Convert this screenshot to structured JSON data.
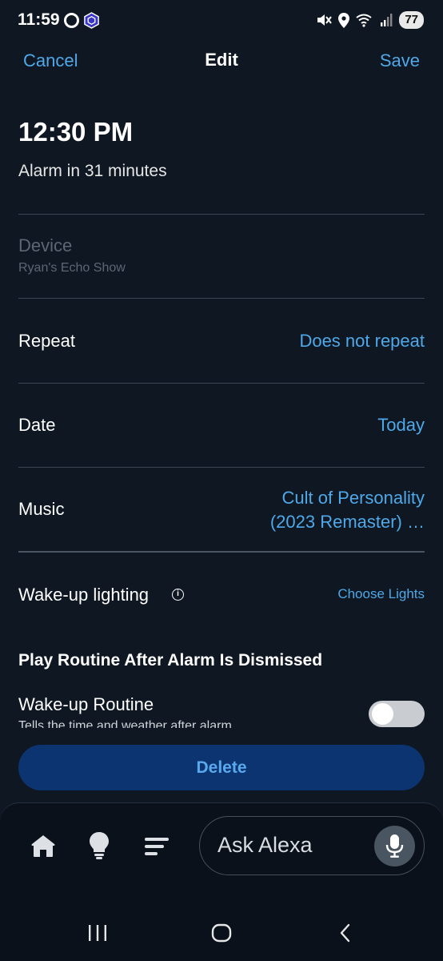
{
  "status_bar": {
    "time": "11:59",
    "battery": "77",
    "icons": [
      "circle-icon",
      "hexagon-app-icon",
      "mute-icon",
      "location-icon",
      "wifi-icon",
      "signal-icon",
      "battery-icon"
    ]
  },
  "header": {
    "cancel": "Cancel",
    "title": "Edit",
    "save": "Save"
  },
  "alarm": {
    "time": "12:30 PM",
    "subtitle": "Alarm in 31 minutes"
  },
  "device": {
    "label": "Device",
    "value": "Ryan's Echo Show"
  },
  "repeat": {
    "label": "Repeat",
    "value": "Does not repeat"
  },
  "date": {
    "label": "Date",
    "value": "Today"
  },
  "music": {
    "label": "Music",
    "value_line1": "Cult of Personality",
    "value_line2": "(2023 Remaster) …"
  },
  "wake_lighting": {
    "label": "Wake-up lighting",
    "info": "i",
    "action": "Choose Lights"
  },
  "routine": {
    "heading": "Play Routine After Alarm Is Dismissed",
    "label": "Wake-up Routine",
    "description": "Tells the time and weather after alarm",
    "enabled": false
  },
  "delete_label": "Delete",
  "bottom_nav": {
    "ask_placeholder": "Ask Alexa",
    "items": [
      "home-icon",
      "lightbulb-icon",
      "list-icon"
    ]
  },
  "colors": {
    "background": "#0f1722",
    "accent": "#4fa8e8",
    "delete_bg": "#0c3470"
  }
}
